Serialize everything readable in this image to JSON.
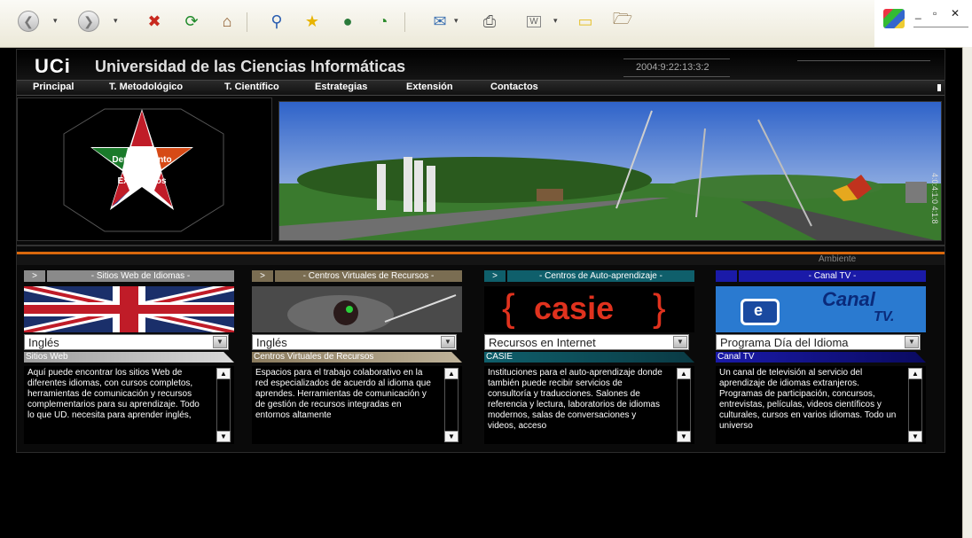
{
  "browser": {
    "toolbar_icons": [
      "back-icon",
      "forward-icon",
      "stop-icon",
      "refresh-icon",
      "home-icon",
      "search-icon",
      "favorites-icon",
      "media-icon",
      "history-icon",
      "mail-icon",
      "print-icon",
      "edit-icon",
      "discuss-icon",
      "messenger-icon"
    ],
    "window_buttons": [
      "_",
      "▫",
      "✕"
    ]
  },
  "site": {
    "logo": "UCi",
    "name": "Universidad de las Ciencias Informáticas",
    "clock": "2004:9:22:13:3:2",
    "nav": [
      "Principal",
      "T. Metodológico",
      "T. Científico",
      "Estrategias",
      "Extensión",
      "Contactos"
    ],
    "star_text": [
      "Departamento",
      "Idiomas",
      "Extranjeros"
    ],
    "photo_side_text": "4:0:4:1:0 4:1:8",
    "ambient_label": "Ambiente"
  },
  "columns": [
    {
      "header": "- Sitios Web de Idiomas -",
      "arrow": ">",
      "select_value": "Inglés",
      "tab": "Sitios Web",
      "description": "Aquí puede encontrar los sitios Web de diferentes idiomas, con cursos completos, herramientas de comunicación y recursos complementarios para su aprendizaje. Todo lo que UD. necesita para aprender inglés,",
      "color": "#9e9e9e"
    },
    {
      "header": "- Centros Virtuales de Recursos -",
      "arrow": ">",
      "select_value": "Inglés",
      "tab": "Centros Virtuales de Recursos",
      "description": "Espacios para el trabajo colaborativo en la red especializados de acuerdo al idioma que aprendes. Herramientas de comunicación y de gestión de recursos integradas en entornos altamente",
      "color": "#8a7b5e"
    },
    {
      "header": "- Centros de Auto-aprendizaje -",
      "arrow": ">",
      "select_value": "Recursos en Internet",
      "tab": "CASIE",
      "description": "Instituciones para el auto-aprendizaje donde también puede recibir servicios de consultoría y traducciones. Salones de referencia y lectura, laboratorios de idiomas modernos, salas de conversaciones y videos, acceso",
      "logo_text": "casie",
      "color": "#0f5f6b"
    },
    {
      "header": "- Canal TV -",
      "arrow": "",
      "select_value": "Programa Día del Idioma",
      "tab": "Canal TV",
      "description": "Un canal de televisión al servicio del aprendizaje de idiomas extranjeros. Programas de participación, concursos, entrevistas, películas, videos científicos y culturales, cursos en varios idiomas. Todo un universo",
      "logo_text": "Canal",
      "logo_sub": "TV.",
      "color": "#1a1aa8"
    }
  ]
}
